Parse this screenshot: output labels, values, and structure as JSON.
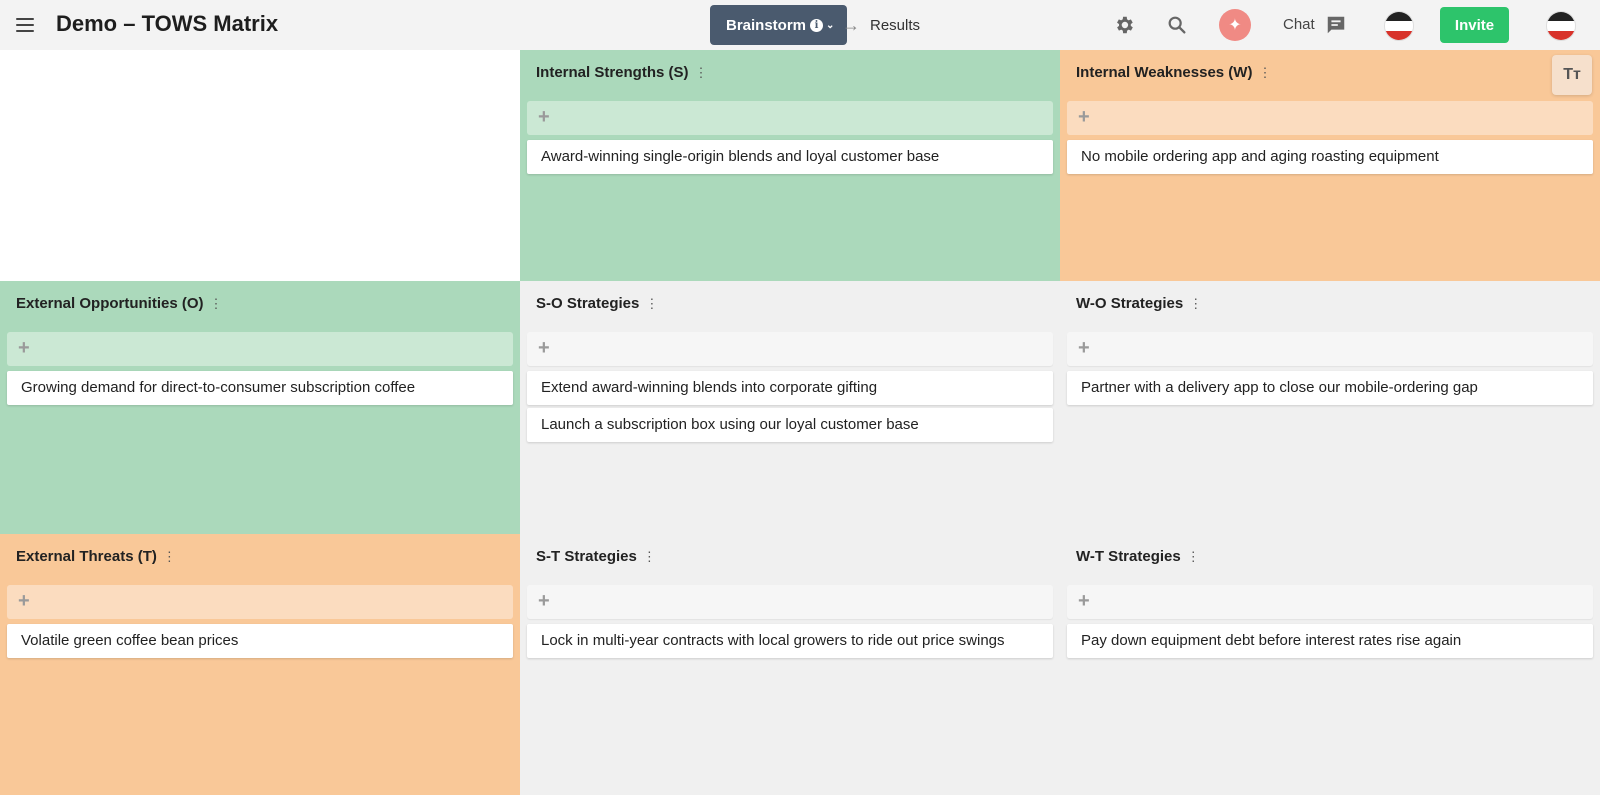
{
  "header": {
    "title": "Demo – TOWS Matrix",
    "tab_active": "Brainstorm",
    "tab_next": "Results",
    "chat_label": "Chat",
    "invite_label": "Invite",
    "info_glyph": "i",
    "arrow_glyph": "→",
    "chev_glyph": "⌄",
    "ai_glyph": "✦"
  },
  "textsize": {
    "label": "Tт"
  },
  "cells": {
    "strengths": {
      "title": "Internal Strengths (S)",
      "notes": [
        "Award-winning single-origin blends and loyal customer base"
      ]
    },
    "weaknesses": {
      "title": "Internal Weaknesses (W)",
      "notes": [
        "No mobile ordering app and aging roasting equipment"
      ]
    },
    "opportunities": {
      "title": "External Opportunities (O)",
      "notes": [
        "Growing demand for direct-to-consumer subscription coffee"
      ]
    },
    "so": {
      "title": "S-O Strategies",
      "notes": [
        "Extend award-winning blends into corporate gifting",
        "Launch a subscription box using our loyal customer base"
      ]
    },
    "wo": {
      "title": "W-O Strategies",
      "notes": [
        "Partner with a delivery app to close our mobile-ordering gap"
      ]
    },
    "threats": {
      "title": "External Threats (T)",
      "notes": [
        "Volatile green coffee bean prices"
      ]
    },
    "st": {
      "title": "S-T Strategies",
      "notes": [
        "Lock in multi-year contracts with local growers to ride out price swings"
      ]
    },
    "wt": {
      "title": "W-T Strategies",
      "notes": [
        "Pay down equipment debt before interest rates rise again"
      ]
    }
  },
  "colors": {
    "green": "#abd9bb",
    "orange": "#f9c898",
    "grey": "#f0f0f0",
    "accent": "#2dc46b",
    "pill": "#4a5a6e"
  },
  "icons": [
    "menu-icon",
    "info-icon",
    "chevron-down-icon",
    "arrow-right-icon",
    "gear-icon",
    "search-icon",
    "sparkle-icon",
    "chat-icon",
    "avatar",
    "text-size-icon",
    "plus-icon",
    "kebab-icon"
  ],
  "kebab_glyph": "⋮",
  "plus_glyph": "+"
}
